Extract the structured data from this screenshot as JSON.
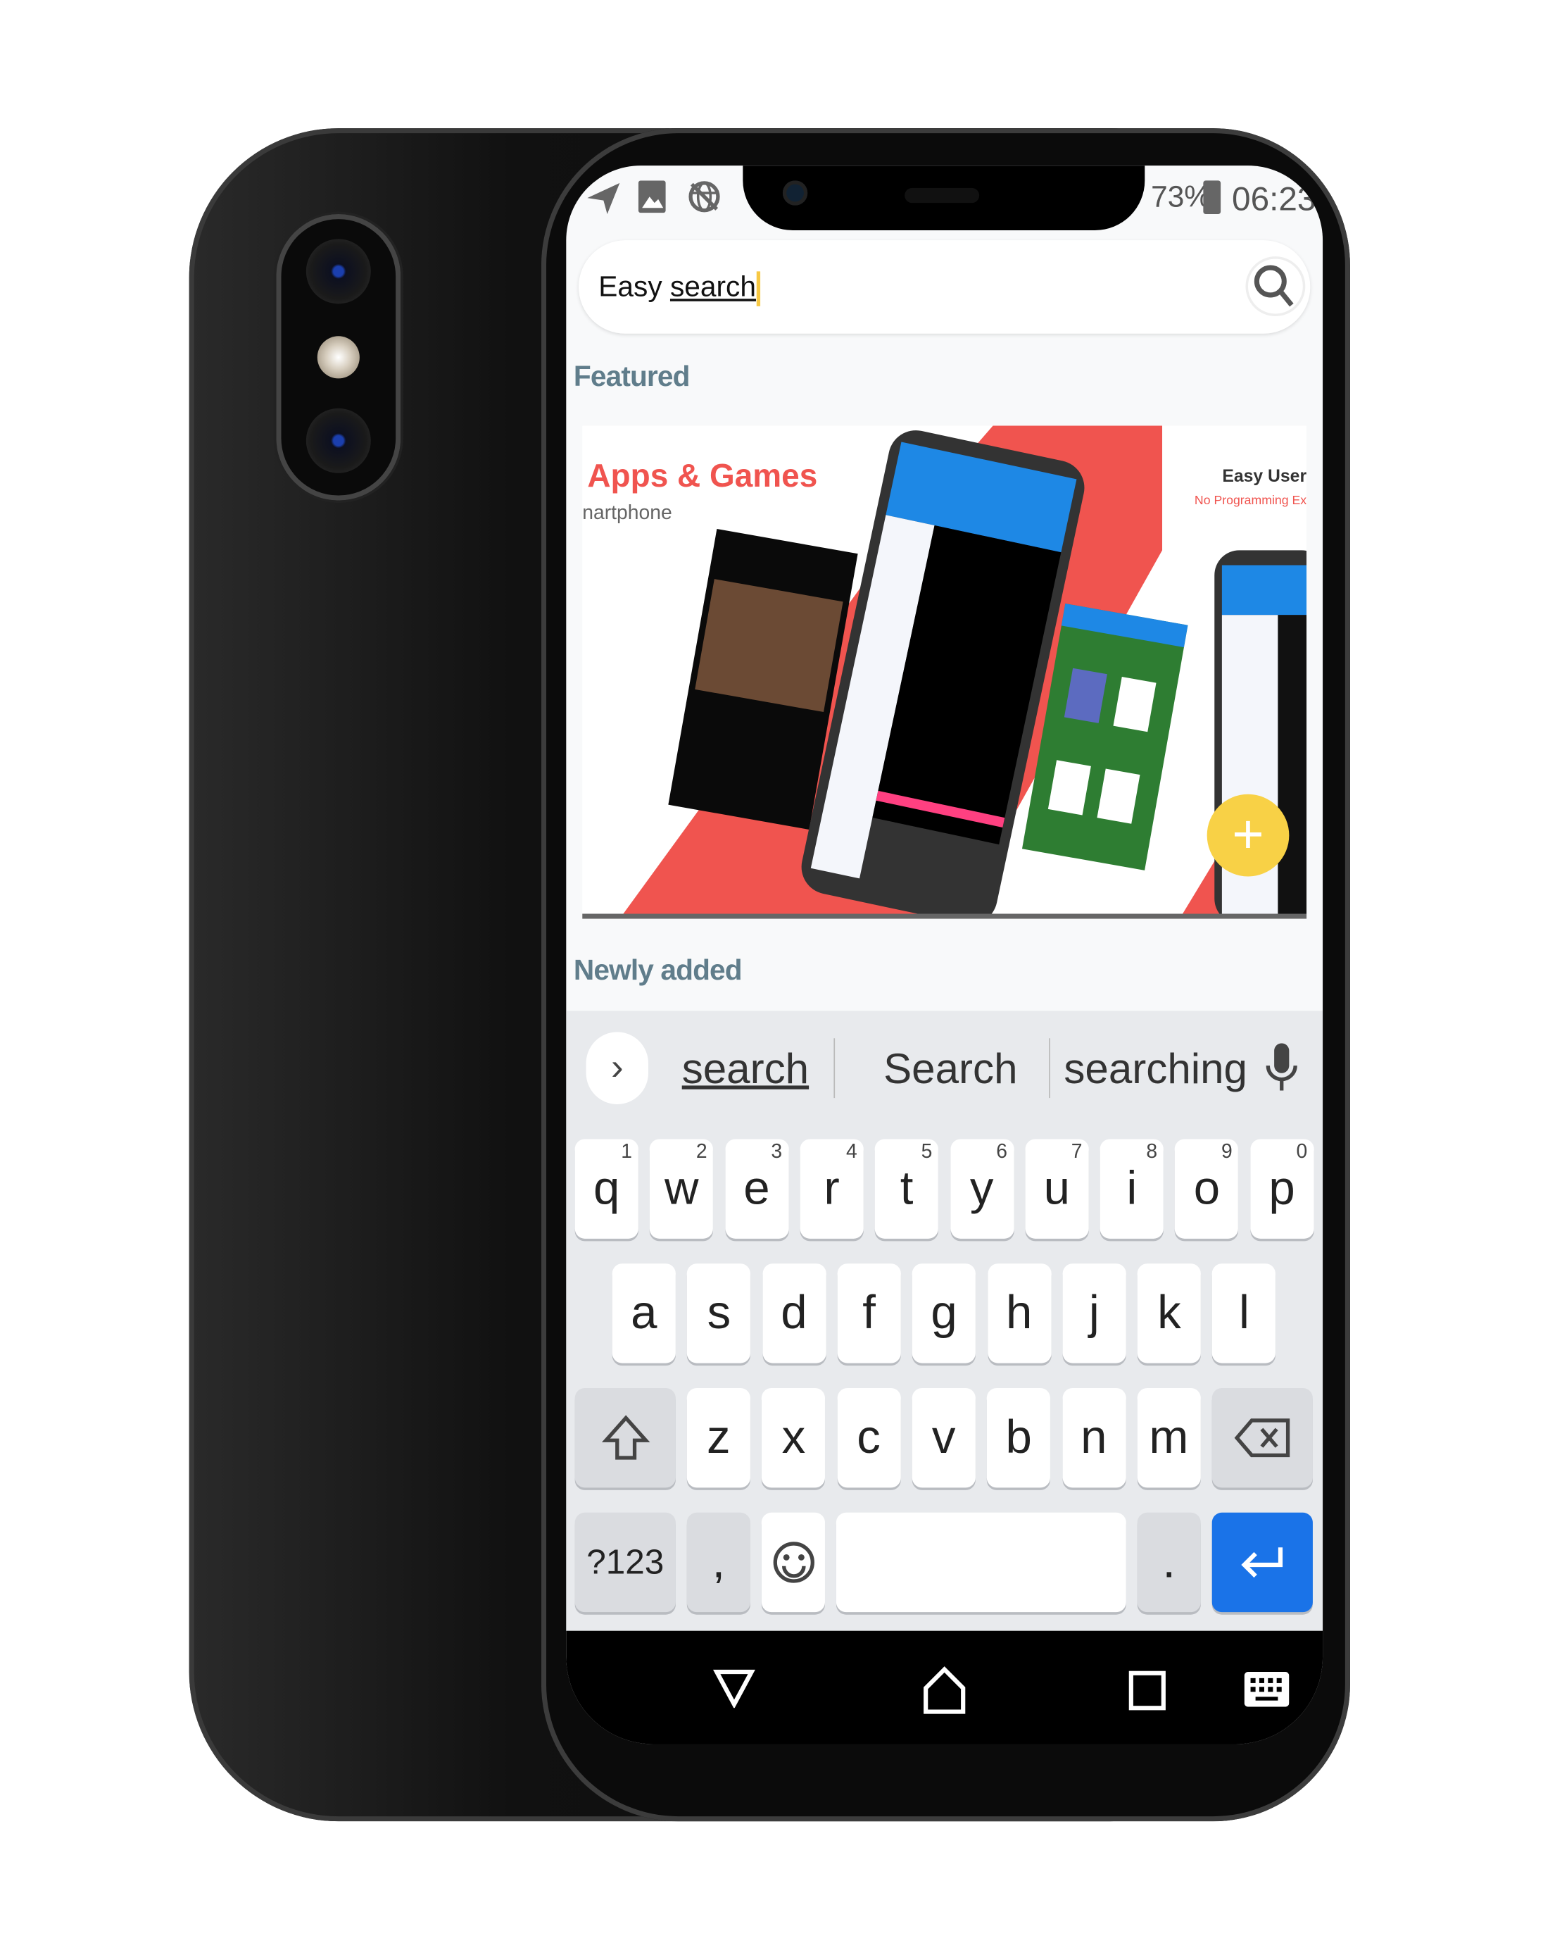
{
  "status_bar": {
    "battery": "73%",
    "time": "06:23",
    "left_icons": [
      "send-icon",
      "image-icon",
      "globe-off-icon"
    ]
  },
  "search": {
    "value_prefix": "Easy ",
    "value_word": "search",
    "icon": "search-icon"
  },
  "sections": {
    "featured": "Featured",
    "newly_added": "Newly added"
  },
  "banner": {
    "title": "Apps & Games",
    "subtitle": "nartphone",
    "right_title": "Easy User",
    "right_subtitle": "No Programming Ex",
    "fab": "+"
  },
  "suggestions": [
    "search",
    "Search",
    "searching"
  ],
  "keyboard": {
    "row1": [
      {
        "k": "q",
        "n": "1"
      },
      {
        "k": "w",
        "n": "2"
      },
      {
        "k": "e",
        "n": "3"
      },
      {
        "k": "r",
        "n": "4"
      },
      {
        "k": "t",
        "n": "5"
      },
      {
        "k": "y",
        "n": "6"
      },
      {
        "k": "u",
        "n": "7"
      },
      {
        "k": "i",
        "n": "8"
      },
      {
        "k": "o",
        "n": "9"
      },
      {
        "k": "p",
        "n": "0"
      }
    ],
    "row2": [
      "a",
      "s",
      "d",
      "f",
      "g",
      "h",
      "j",
      "k",
      "l"
    ],
    "row3": [
      "z",
      "x",
      "c",
      "v",
      "b",
      "n",
      "m"
    ],
    "symbols": "?123",
    "comma": ",",
    "period": ".",
    "enter_color": "#1a73e8"
  },
  "colors": {
    "accent": "#1a73e8",
    "section": "#607d8b",
    "banner_red": "#f0544f",
    "fab": "#f8d146"
  }
}
